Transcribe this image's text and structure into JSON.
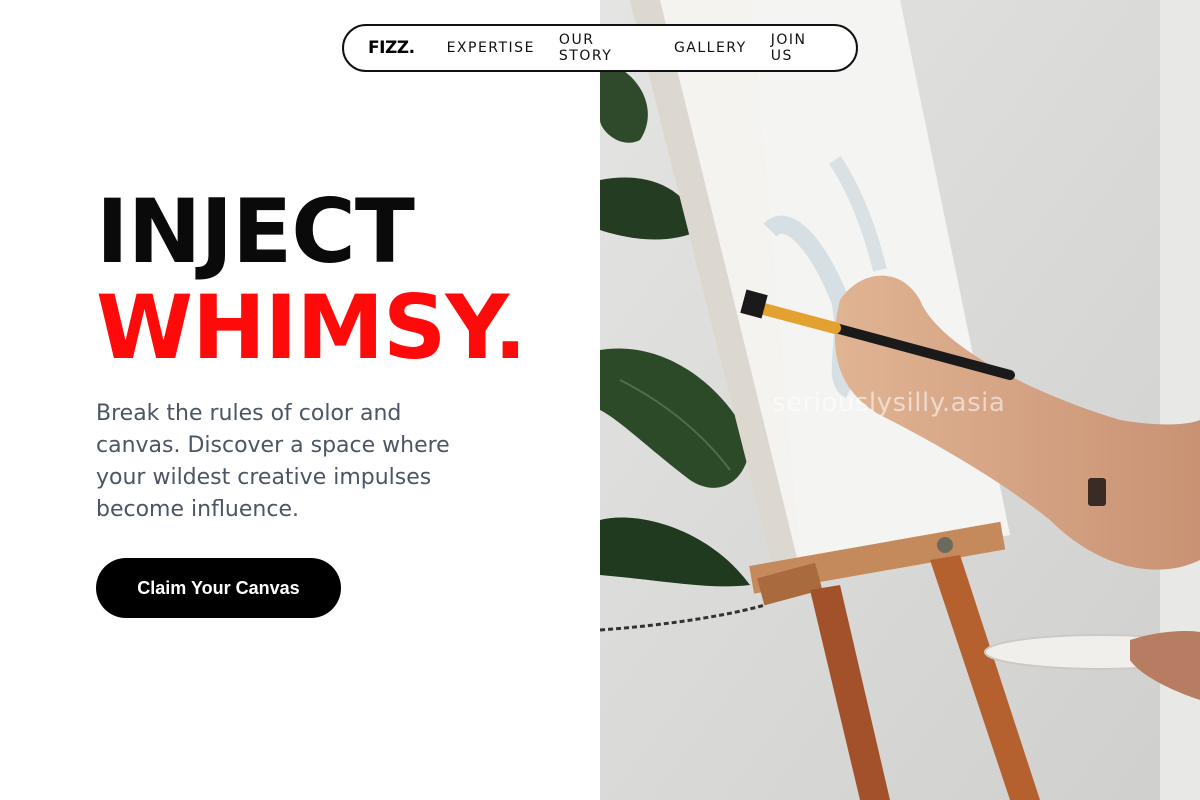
{
  "nav": {
    "brand": "FIZZ.",
    "links": [
      "EXPERTISE",
      "OUR STORY",
      "GALLERY",
      "JOIN US"
    ]
  },
  "hero": {
    "headline_line1": "INJECT",
    "headline_line2": "WHIMSY.",
    "subtext": "Break the rules of color and canvas. Discover a space where your wildest creative impulses become influence.",
    "cta_label": "Claim Your Canvas"
  },
  "image": {
    "description_icon": "painting-photo",
    "watermark": "seriouslysilly.asia"
  },
  "colors": {
    "accent": "#ff0a0a",
    "headline": "#0a0a0a",
    "body_text": "#4b5563",
    "button_bg": "#000000",
    "button_text": "#ffffff"
  }
}
